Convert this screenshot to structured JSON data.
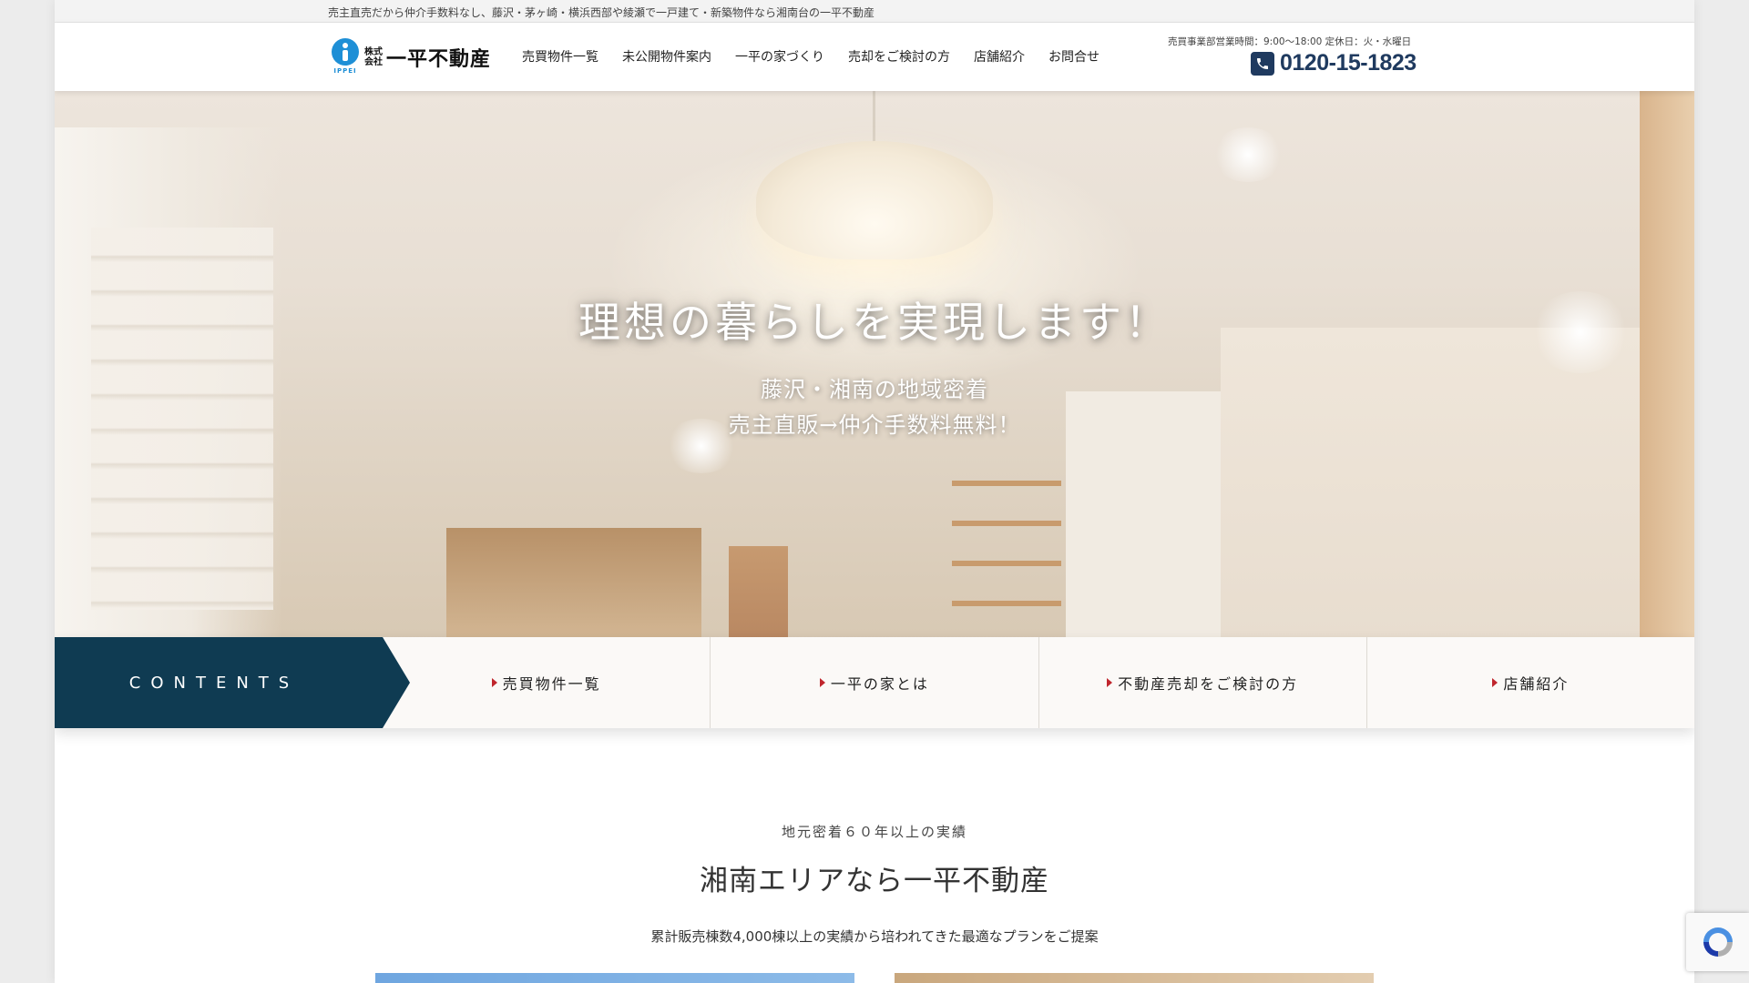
{
  "topbar": {
    "tagline": "売主直売だから仲介手数料なし、藤沢・茅ヶ崎・横浜西部や綾瀬で一戸建て・新築物件なら湘南台の一平不動産"
  },
  "header": {
    "logo": {
      "mark_text": "IPPEI",
      "kabu_top": "株式",
      "kabu_bottom": "会社",
      "name": "一平不動産"
    },
    "nav": [
      {
        "label": "売買物件一覧"
      },
      {
        "label": "未公開物件案内"
      },
      {
        "label": "一平の家づくり"
      },
      {
        "label": "売却をご検討の方"
      },
      {
        "label": "店舗紹介"
      },
      {
        "label": "お問合せ"
      }
    ],
    "hours": "売買事業部営業時間：9:00～18:00 定休日：火・水曜日",
    "phone": "0120-15-1823",
    "phone_icon": "phone-icon"
  },
  "hero": {
    "title": "理想の暮らしを実現します！",
    "sub_line1": "藤沢・湘南の地域密着",
    "sub_line2": "売主直販→仲介手数料無料！"
  },
  "contents": {
    "label": "CONTENTS",
    "links": [
      {
        "label": "売買物件一覧"
      },
      {
        "label": "一平の家とは"
      },
      {
        "label": "不動産売却をご検討の方"
      },
      {
        "label": "店舗紹介"
      }
    ]
  },
  "intro": {
    "eyebrow": "地元密着６０年以上の実績",
    "title": "湘南エリアなら一平不動産",
    "description": "累計販売棟数4,000棟以上の実績から培われてきた最適なプランをご提案"
  },
  "colors": {
    "navy": "#0f3b52",
    "phone": "#1f3a5f",
    "brand_blue": "#1e8fd6",
    "arrow_red": "#c0262d"
  }
}
